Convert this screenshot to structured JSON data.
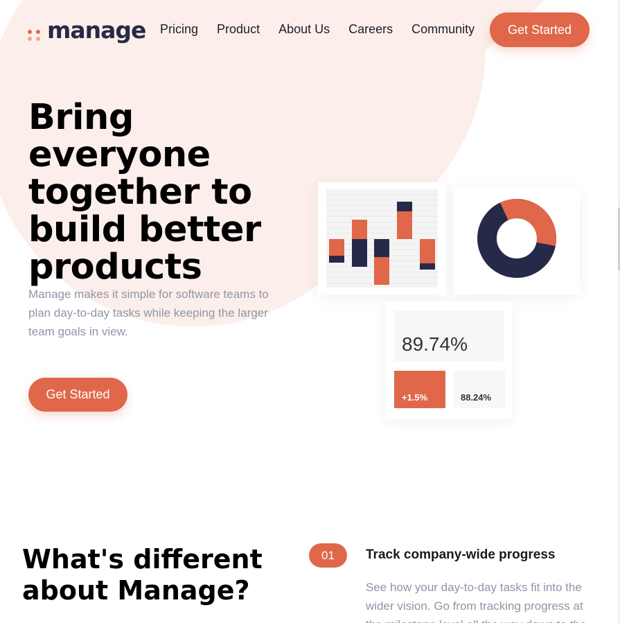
{
  "brand": {
    "name": "manage",
    "accent": "#e0674a",
    "dark": "#262a48"
  },
  "nav": {
    "items": [
      "Pricing",
      "Product",
      "About Us",
      "Careers",
      "Community"
    ]
  },
  "header": {
    "cta_label": "Get Started"
  },
  "hero": {
    "title_lines": [
      "Bring everyone",
      "together to",
      "build better",
      "products"
    ],
    "description": "Manage makes it simple for software teams to plan day-to-day tasks while keeping the larger team goals in view.",
    "cta_label": "Get Started"
  },
  "illustration": {
    "stat_main": "89.74%",
    "stat_change": "+1.5%",
    "stat_secondary": "88.24%",
    "donut_fraction_accent": 0.35
  },
  "features": {
    "title_lines": [
      "What's different",
      "about Manage?"
    ],
    "items": [
      {
        "number": "01",
        "title": "Track company-wide progress",
        "description": "See how your day-to-day tasks fit into the wider vision. Go from tracking progress at the milestone level all the way down to the smallest of details."
      }
    ]
  }
}
